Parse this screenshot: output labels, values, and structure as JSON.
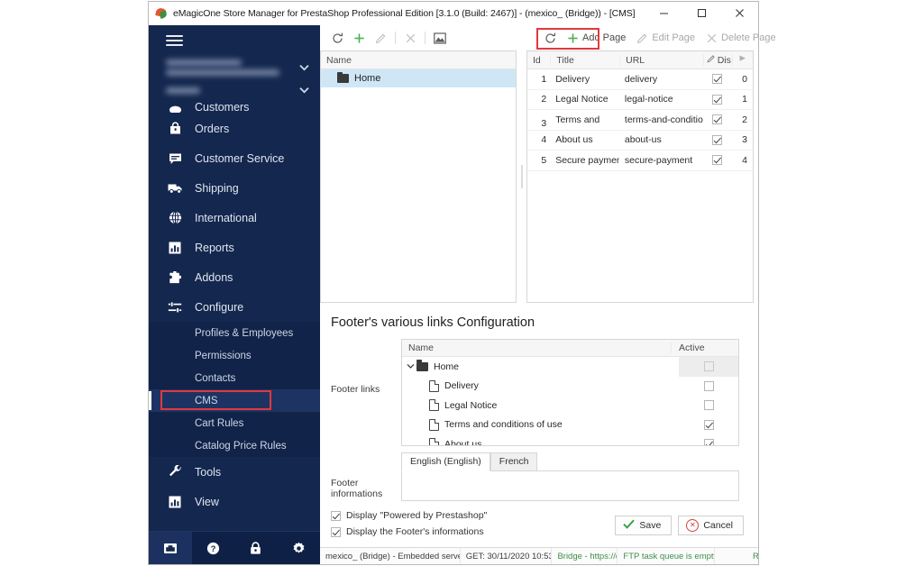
{
  "window": {
    "title": "eMagicOne Store Manager for PrestaShop Professional Edition [3.1.0 (Build: 2467)] - (mexico_ (Bridge)) - [CMS]",
    "app_icon": "prestashop-leaf-icon",
    "minimize_label": "–",
    "maximize_label": "□",
    "close_label": "✕"
  },
  "sidebar": {
    "menu_icon": "hamburger-icon",
    "store_selector": {
      "chevron": "chevron-down-icon",
      "redacted": true
    },
    "section_selector": {
      "chevron": "chevron-down-icon",
      "redacted": true
    },
    "items": [
      {
        "label": "Customers",
        "icon": "customers-icon",
        "clipped": true
      },
      {
        "label": "Orders",
        "icon": "orders-bag-icon"
      },
      {
        "label": "Customer Service",
        "icon": "chat-bubble-icon"
      },
      {
        "label": "Shipping",
        "icon": "truck-icon"
      },
      {
        "label": "International",
        "icon": "globe-icon"
      },
      {
        "label": "Reports",
        "icon": "bar-chart-icon"
      },
      {
        "label": "Addons",
        "icon": "puzzle-icon"
      },
      {
        "label": "Configure",
        "icon": "sliders-icon"
      }
    ],
    "sub_items": [
      {
        "label": "Profiles & Employees",
        "active": false
      },
      {
        "label": "Permissions",
        "active": false
      },
      {
        "label": "Contacts",
        "active": false
      },
      {
        "label": "CMS",
        "active": true,
        "highlighted": true
      },
      {
        "label": "Cart Rules",
        "active": false
      },
      {
        "label": "Catalog Price Rules",
        "active": false
      }
    ],
    "items_after": [
      {
        "label": "Tools",
        "icon": "wrench-icon"
      },
      {
        "label": "View",
        "icon": "bar-chart-icon"
      }
    ],
    "bottom_icons": [
      {
        "name": "inbox-icon",
        "active": true
      },
      {
        "name": "help-icon",
        "active": false
      },
      {
        "name": "lock-icon",
        "active": false
      },
      {
        "name": "gear-icon",
        "active": false
      }
    ],
    "highlight_color": "#e0393e"
  },
  "toolbar_tree": {
    "buttons": [
      {
        "name": "refresh-icon",
        "label": "",
        "enabled": true
      },
      {
        "name": "add-icon",
        "label": "",
        "enabled": true
      },
      {
        "name": "edit-icon",
        "label": "",
        "enabled": false
      },
      {
        "name": "delete-icon",
        "label": "",
        "enabled": false
      },
      {
        "name": "image-icon",
        "label": "",
        "enabled": true
      }
    ]
  },
  "toolbar_grid": {
    "refresh_icon": "refresh-icon",
    "add_page_label": "Add Page",
    "edit_page_label": "Edit Page",
    "delete_page_label": "Delete Page",
    "highlight_color": "#e0393e"
  },
  "tree_panel": {
    "column_header": "Name",
    "rows": [
      {
        "label": "Home",
        "icon": "folder-icon",
        "selected": true
      }
    ]
  },
  "grid_panel": {
    "columns": [
      "Id",
      "Title",
      "URL",
      "Dis",
      ""
    ],
    "dis_icon": "pencil-icon",
    "pos_icon": "sort-icon",
    "rows": [
      {
        "id": "1",
        "title": "Delivery",
        "url": "delivery",
        "displayed": true,
        "position": "0"
      },
      {
        "id": "2",
        "title": "Legal Notice",
        "url": "legal-notice",
        "displayed": true,
        "position": "1"
      },
      {
        "id": "3",
        "title": "Terms and",
        "url": "terms-and-conditions-o",
        "displayed": true,
        "position": "2"
      },
      {
        "id": "4",
        "title": "About us",
        "url": "about-us",
        "displayed": true,
        "position": "3"
      },
      {
        "id": "5",
        "title": "Secure payment",
        "url": "secure-payment",
        "displayed": true,
        "position": "4"
      }
    ]
  },
  "footer_config": {
    "title": "Footer's various links Configuration",
    "footer_links_label": "Footer links",
    "columns": {
      "name": "Name",
      "active": "Active"
    },
    "rows": [
      {
        "label": "Home",
        "icon": "folder-icon",
        "level": 0,
        "expanded": true,
        "chevron": "chevron-down-icon",
        "active": false,
        "shaded": true
      },
      {
        "label": "Delivery",
        "icon": "document-icon",
        "level": 1,
        "active": false,
        "shaded": false
      },
      {
        "label": "Legal Notice",
        "icon": "document-icon",
        "level": 1,
        "active": false,
        "shaded": false
      },
      {
        "label": "Terms and conditions of use",
        "icon": "document-icon",
        "level": 1,
        "active": true,
        "shaded": false
      },
      {
        "label": "About us",
        "icon": "document-icon",
        "level": 1,
        "active": true,
        "shaded": false
      }
    ],
    "language_tabs": [
      {
        "label": "English (English)",
        "active": true
      },
      {
        "label": "French",
        "active": false
      }
    ],
    "footer_info_label": "Footer informations",
    "footer_info_value": "",
    "footer_info_placeholder": "",
    "checkboxes": [
      {
        "label": "Display \"Powered by Prestashop\"",
        "checked": true
      },
      {
        "label": "Display the Footer's informations",
        "checked": true
      }
    ],
    "save_label": "Save",
    "cancel_label": "Cancel",
    "save_icon": "check-icon",
    "cancel_icon": "cancel-circle-icon"
  },
  "statusbar": {
    "cells": [
      {
        "text": "mexico_ (Bridge) - Embedded server:qa_emagic",
        "green": false
      },
      {
        "text": "GET: 30/11/2020 10:53",
        "green": false
      },
      {
        "text": "Bridge - https://qa.ema",
        "green": true
      },
      {
        "text": "FTP task queue is empty",
        "green": true
      },
      {
        "text": "Re-index list is empty",
        "green": true
      }
    ]
  }
}
